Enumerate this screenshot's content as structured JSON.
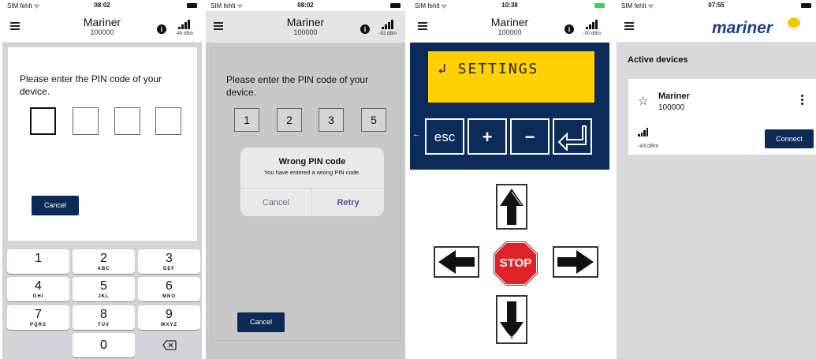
{
  "colors": {
    "navy": "#0b2a55",
    "lcd_yellow": "#ffd100",
    "stop_red": "#e0222b",
    "logo_blue": "#1f3f86",
    "logo_yellow": "#f6c400"
  },
  "screen1": {
    "status": {
      "carrier": "SIM fehlt ᯤ",
      "time": "08:02"
    },
    "header": {
      "title": "Mariner",
      "subtitle": "100000",
      "signal_dbm": "-49 dBm"
    },
    "prompt": "Please enter the PIN code of your device.",
    "pin_digits": [
      "",
      "",
      "",
      ""
    ],
    "cancel_label": "Cancel",
    "keypad": [
      {
        "digit": "1",
        "letters": ""
      },
      {
        "digit": "2",
        "letters": "ABC"
      },
      {
        "digit": "3",
        "letters": "DEF"
      },
      {
        "digit": "4",
        "letters": "GHI"
      },
      {
        "digit": "5",
        "letters": "JKL"
      },
      {
        "digit": "6",
        "letters": "MNO"
      },
      {
        "digit": "7",
        "letters": "PQRS"
      },
      {
        "digit": "8",
        "letters": "TUV"
      },
      {
        "digit": "9",
        "letters": "WXYZ"
      },
      {
        "digit": "0",
        "letters": ""
      }
    ],
    "backspace_icon": "backspace-icon"
  },
  "screen2": {
    "status": {
      "carrier": "SIM fehlt ᯤ",
      "time": "08:02"
    },
    "header": {
      "title": "Mariner",
      "subtitle": "100000",
      "signal_dbm": "-53 dBm"
    },
    "prompt": "Please enter the PIN code of your device.",
    "pin_digits": [
      "1",
      "2",
      "3",
      "5"
    ],
    "dialog": {
      "title": "Wrong PIN code",
      "message": "You have entered a wrong PIN code.",
      "cancel": "Cancel",
      "retry": "Retry"
    },
    "cancel_label": "Cancel"
  },
  "screen3": {
    "status": {
      "carrier": "SIM fehlt ᯤ",
      "time": "10:38"
    },
    "header": {
      "title": "Mariner",
      "subtitle": "100000",
      "signal_dbm": "-50 dBm"
    },
    "lcd_text": "↲ SETTINGS",
    "buttons": {
      "esc": "esc",
      "plus": "+",
      "minus": "−",
      "enter": "↲"
    },
    "stop_label": "STOP"
  },
  "screen4": {
    "status": {
      "carrier": "SIM fehlt ᯤ",
      "time": "07:55"
    },
    "logo_text": "mariner",
    "section_title": "Active devices",
    "device": {
      "name": "Mariner",
      "id": "100000",
      "signal_dbm": "-43 dBm",
      "connect": "Connect"
    }
  }
}
